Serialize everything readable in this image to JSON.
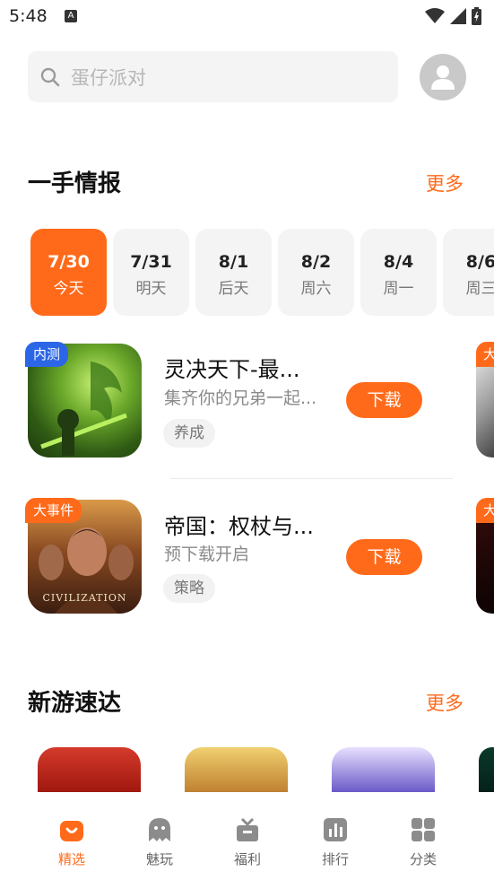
{
  "status_bar": {
    "time": "5:48",
    "notif_letter": "A"
  },
  "search": {
    "placeholder": "蛋仔派对"
  },
  "news_section": {
    "title": "一手情报",
    "more_label": "更多",
    "dates": [
      {
        "date": "7/30",
        "weekday": "今天",
        "active": true
      },
      {
        "date": "7/31",
        "weekday": "明天",
        "active": false
      },
      {
        "date": "8/1",
        "weekday": "后天",
        "active": false
      },
      {
        "date": "8/2",
        "weekday": "周六",
        "active": false
      },
      {
        "date": "8/4",
        "weekday": "周一",
        "active": false
      },
      {
        "date": "8/6",
        "weekday": "周三",
        "active": false
      }
    ],
    "games": [
      {
        "badge": "内测",
        "name": "灵决天下-最...",
        "desc": "集齐你的兄弟一起...",
        "tag": "养成",
        "button": "下载"
      },
      {
        "badge": "大事件",
        "name": "帝国：权杖与...",
        "desc": "预下载开启",
        "tag": "策略",
        "button": "下载",
        "thumb_text": "CIVILIZATION"
      }
    ],
    "peek_badge": "大"
  },
  "new_section": {
    "title": "新游速达",
    "more_label": "更多"
  },
  "bottom_nav": [
    {
      "label": "精选",
      "icon": "featured-icon",
      "active": true
    },
    {
      "label": "魅玩",
      "icon": "ghost-icon",
      "active": false
    },
    {
      "label": "福利",
      "icon": "gift-icon",
      "active": false
    },
    {
      "label": "排行",
      "icon": "chart-icon",
      "active": false
    },
    {
      "label": "分类",
      "icon": "grid-icon",
      "active": false
    }
  ],
  "colors": {
    "accent": "#ff6a1a",
    "badge_blue": "#2b66e6",
    "chip_bg": "#f4f4f4"
  }
}
